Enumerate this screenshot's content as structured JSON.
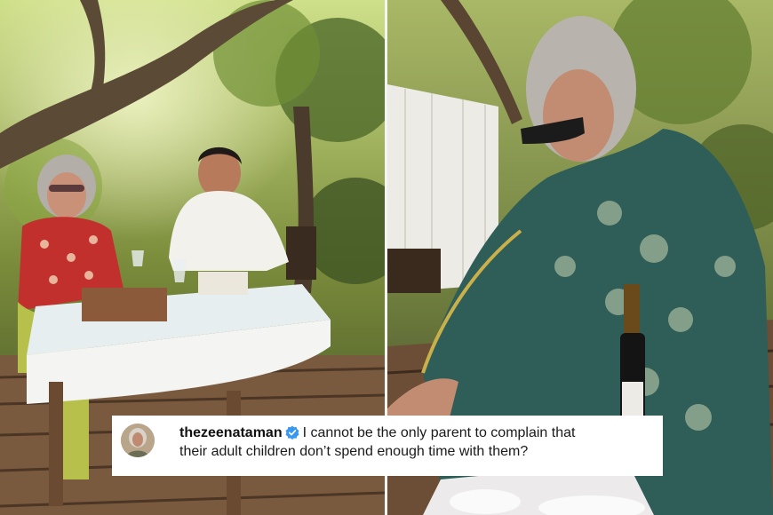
{
  "caption": {
    "username": "thezeenataman",
    "text_line1": "I cannot be the only parent to complain that",
    "text_line2": "their adult children don’t spend enough time with them?"
  },
  "colors": {
    "verified_badge": "#3897f0",
    "divider": "#f4f4f4"
  },
  "icons": [
    "verified-badge-icon"
  ]
}
